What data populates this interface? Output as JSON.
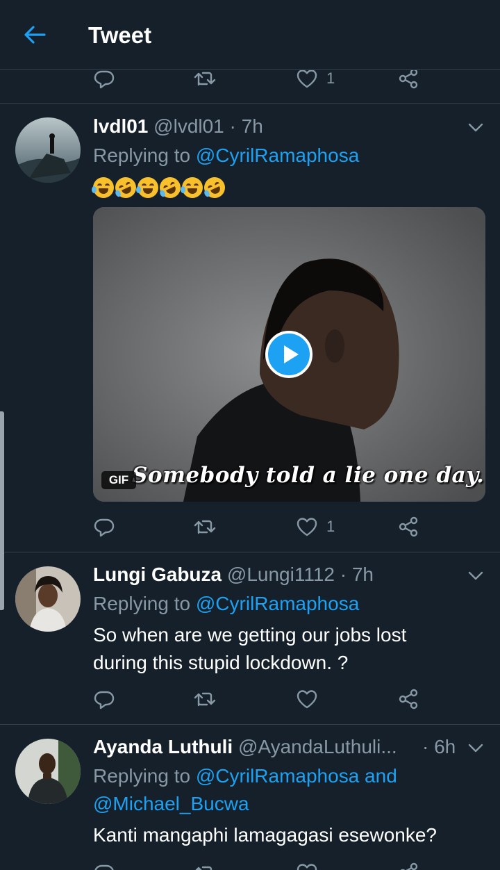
{
  "header": {
    "title": "Tweet"
  },
  "top_actions": {
    "like_count": "1"
  },
  "tweets": [
    {
      "name": "lvdl01",
      "handle_time": "@lvdl01 · 7h",
      "replying_prefix": "Replying to",
      "replying_to": "@CyrilRamaphosa",
      "replying_to_extra": "",
      "body": "",
      "emoji": [
        "face-with-tears-of-joy",
        "rolling-on-the-floor-laughing",
        "face-with-tears-of-joy",
        "rolling-on-the-floor-laughing",
        "face-with-tears-of-joy",
        "rolling-on-the-floor-laughing"
      ],
      "media": {
        "badge": "GIF",
        "caption": "Somebody told a lie one day."
      },
      "like_count": "1"
    },
    {
      "name": "Lungi Gabuza",
      "handle_time": "@Lungi1112 · 7h",
      "replying_prefix": "Replying to",
      "replying_to": "@CyrilRamaphosa",
      "replying_to_extra": "",
      "body_line1": "So when are we getting our jobs lost",
      "body_line2": "during this stupid lockdown. ?",
      "like_count": ""
    },
    {
      "name": "Ayanda Luthuli",
      "handle": "@AyandaLuthuli...",
      "time": "· 6h",
      "replying_prefix": "Replying to",
      "replying_to": "@CyrilRamaphosa and",
      "replying_to_line2": "@Michael_Bucwa",
      "body": "Kanti mangaphi lamagagasi esewonke?"
    }
  ],
  "colors": {
    "background": "#15202b",
    "accent": "#1da1f2",
    "muted": "#8899a6",
    "divider": "#38444d"
  }
}
